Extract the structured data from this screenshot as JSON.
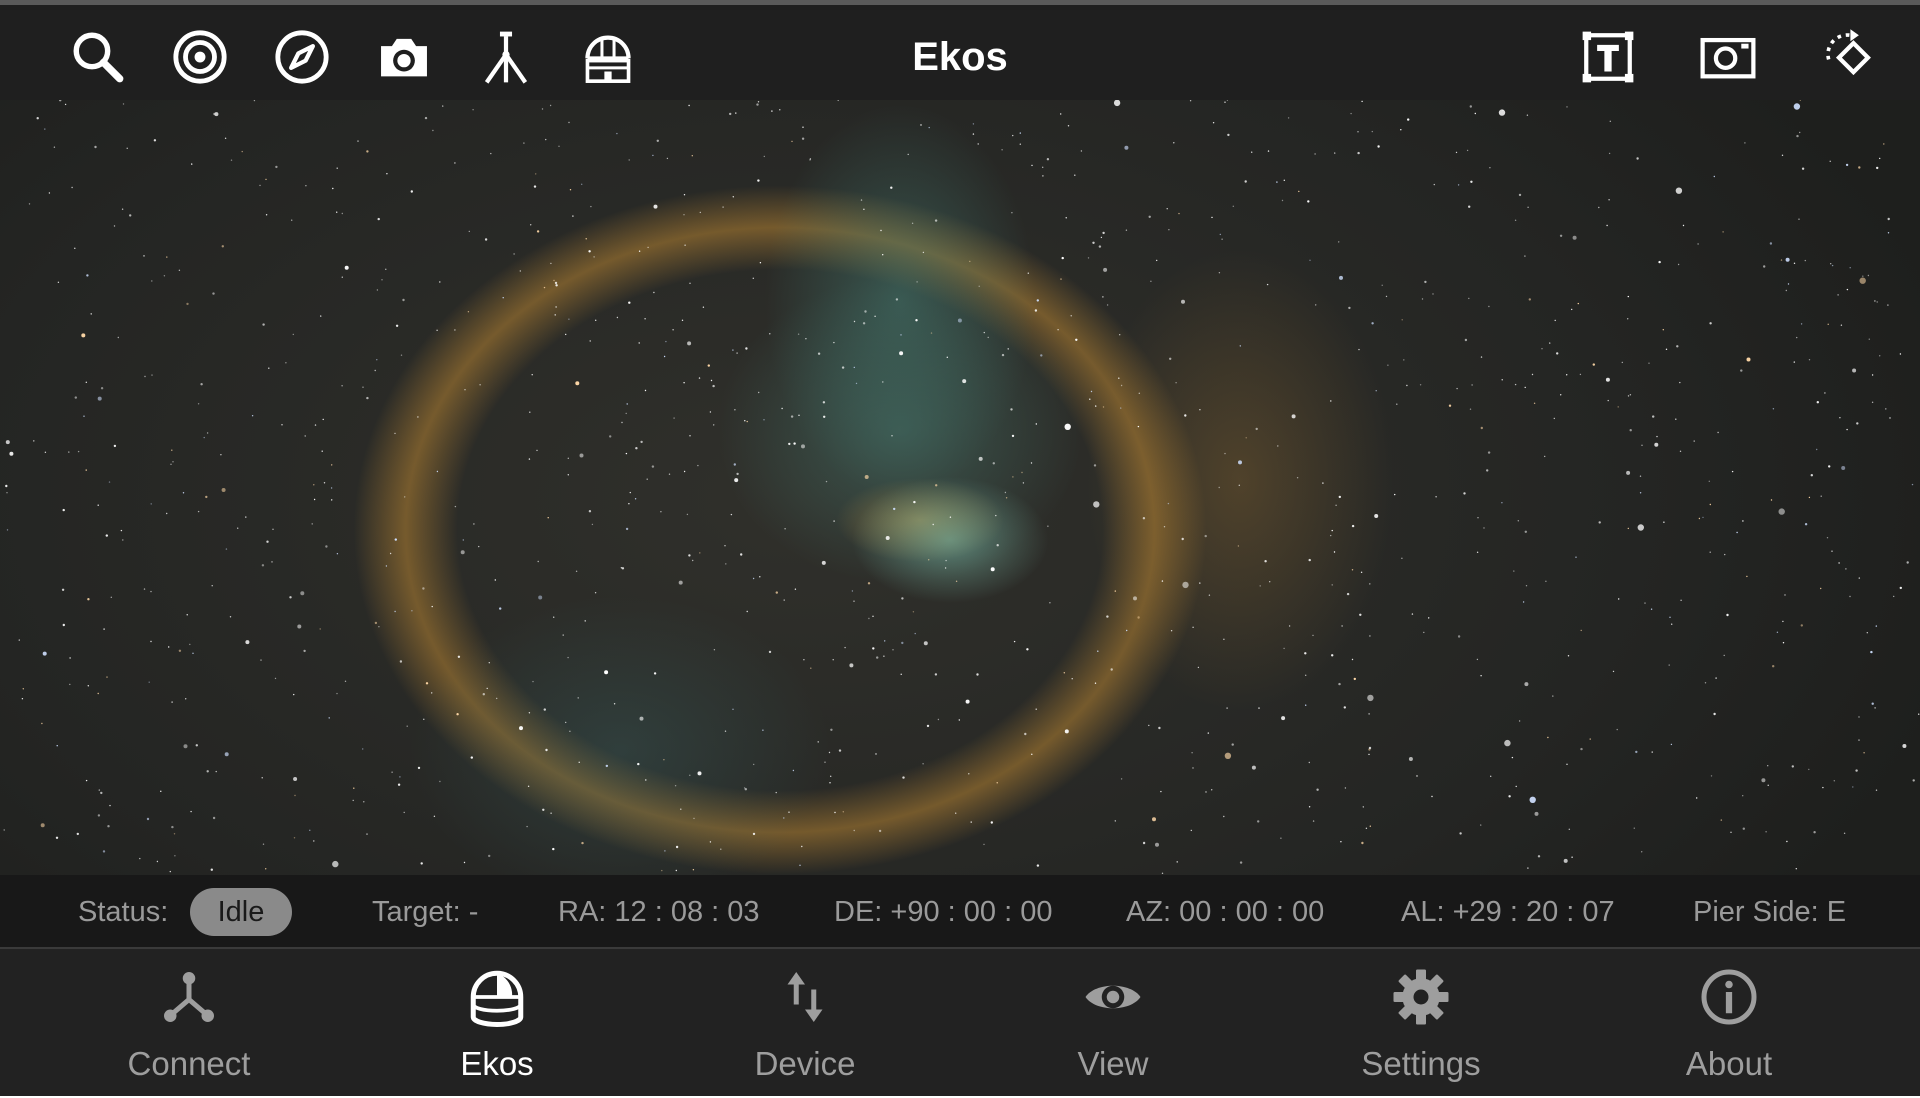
{
  "app": {
    "title": "Ekos"
  },
  "toolbar": {
    "left_icons": [
      "search-icon",
      "target-icon",
      "compass-icon",
      "camera-icon",
      "telescope-icon",
      "observatory-icon"
    ],
    "right_icons": [
      "text-frame-icon",
      "screenshot-icon",
      "rotate-icon"
    ]
  },
  "status": {
    "status_label": "Status:",
    "state": "Idle",
    "target": "Target: -",
    "ra": "RA: 12 : 08 : 03",
    "de": "DE: +90 : 00 : 00",
    "az": "AZ: 00 : 00 : 00",
    "al": "AL: +29 : 20 : 07",
    "pier_side": "Pier Side: E"
  },
  "nav": {
    "items": [
      {
        "label": "Connect",
        "icon": "connect-icon",
        "active": false
      },
      {
        "label": "Ekos",
        "icon": "ekos-dome-icon",
        "active": true
      },
      {
        "label": "Device",
        "icon": "device-arrows-icon",
        "active": false
      },
      {
        "label": "View",
        "icon": "eye-icon",
        "active": false
      },
      {
        "label": "Settings",
        "icon": "gear-icon",
        "active": false
      },
      {
        "label": "About",
        "icon": "info-icon",
        "active": false
      }
    ]
  },
  "colors": {
    "toolbar_bg": "#1f1f1f",
    "nav_bg": "#222222",
    "status_bg": "#181818",
    "active": "#ffffff",
    "inactive": "#9e9e9e"
  }
}
